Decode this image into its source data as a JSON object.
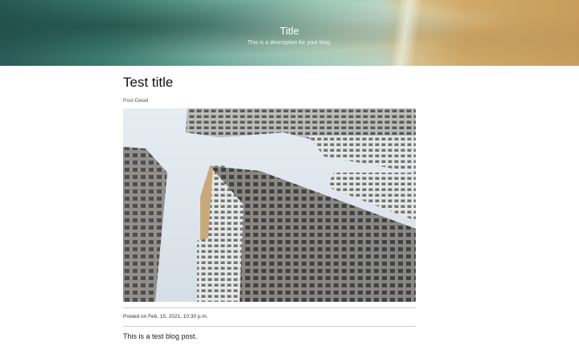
{
  "header": {
    "title": "Title",
    "description": "This is a description for your blog."
  },
  "post": {
    "title": "Test title",
    "subtitle": "Post Detail",
    "image_alt": "Looking up at high-rise apartment buildings",
    "posted_on": "Posted on Feb. 15, 2021, 10:30 p.m.",
    "body": "This is a test blog post."
  }
}
